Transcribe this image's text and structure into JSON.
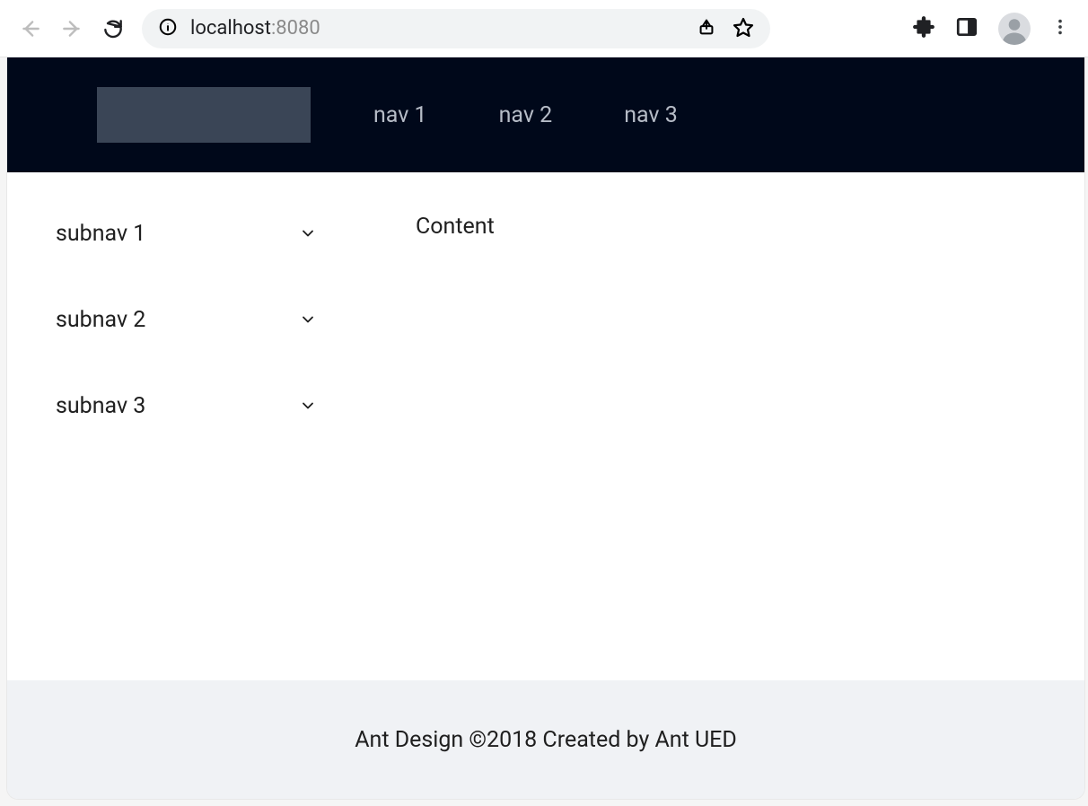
{
  "browser": {
    "url_host": "localhost",
    "url_port": ":8080"
  },
  "header": {
    "nav": [
      {
        "label": "nav 1"
      },
      {
        "label": "nav 2"
      },
      {
        "label": "nav 3"
      }
    ]
  },
  "sidebar": {
    "items": [
      {
        "label": "subnav 1"
      },
      {
        "label": "subnav 2"
      },
      {
        "label": "subnav 3"
      }
    ]
  },
  "content": {
    "text": "Content"
  },
  "footer": {
    "text": "Ant Design ©2018 Created by Ant UED"
  }
}
